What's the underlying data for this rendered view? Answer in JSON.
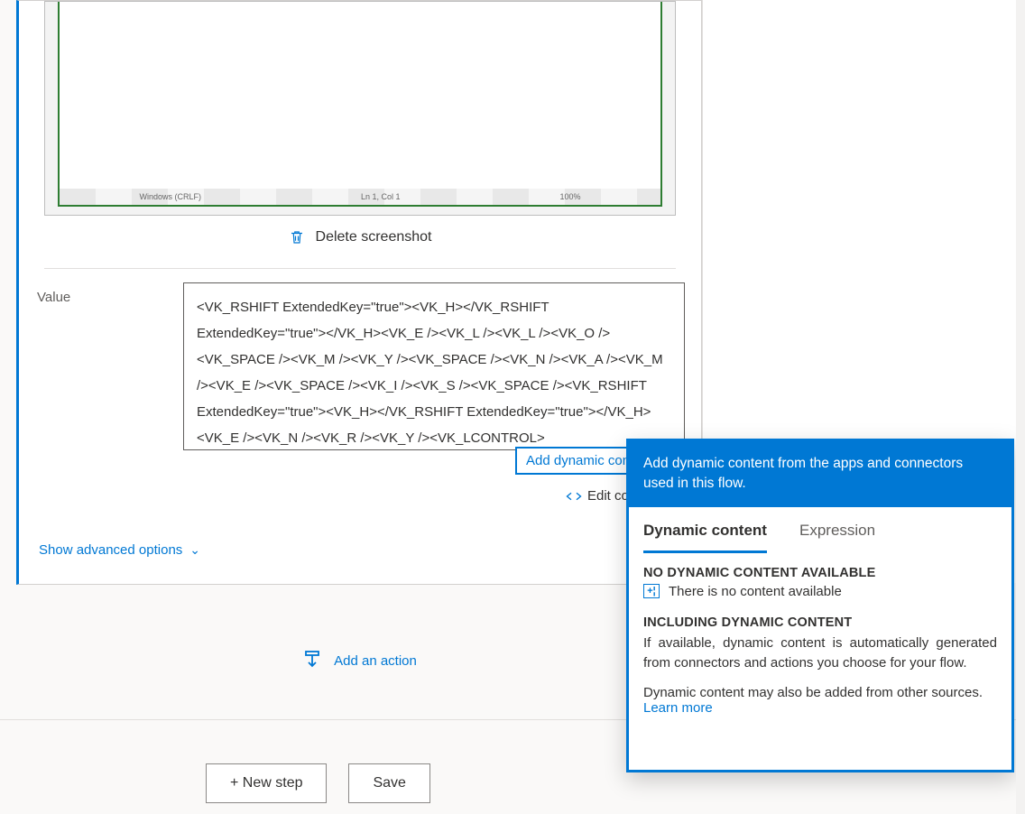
{
  "card": {
    "screenshot_footer": {
      "a": "Windows (CRLF)",
      "b": "Ln 1, Col 1",
      "c": "100%"
    },
    "delete_label": "Delete screenshot",
    "value_label": "Value",
    "value_text": "<VK_RSHIFT ExtendedKey=\"true\"><VK_H></VK_RSHIFT ExtendedKey=\"true\"></VK_H><VK_E /><VK_L /><VK_L /><VK_O /><VK_SPACE /><VK_M /><VK_Y /><VK_SPACE /><VK_N /><VK_A /><VK_M /><VK_E /><VK_SPACE /><VK_I /><VK_S /><VK_SPACE /><VK_RSHIFT ExtendedKey=\"true\"><VK_H></VK_RSHIFT ExtendedKey=\"true\"></VK_H><VK_E /><VK_N /><VK_R /><VK_Y /><VK_LCONTROL>",
    "dynamic_link": "Add dynamic con",
    "edit_code_label": "Edit co",
    "show_advanced": "Show advanced options"
  },
  "add_action": "Add an action",
  "buttons": {
    "new_step": "+ New step",
    "save": "Save"
  },
  "flyout": {
    "header": "Add dynamic content from the apps and connectors used in this flow.",
    "tabs": {
      "dynamic": "Dynamic content",
      "expression": "Expression"
    },
    "no_title": "NO DYNAMIC CONTENT AVAILABLE",
    "no_text": "There is no content available",
    "inc_title": "INCLUDING DYNAMIC CONTENT",
    "inc_text": "If available, dynamic content is automatically generated from connectors and actions you choose for your flow.",
    "other_text": "Dynamic content may also be added from other sources.",
    "learn_more": "Learn more"
  }
}
